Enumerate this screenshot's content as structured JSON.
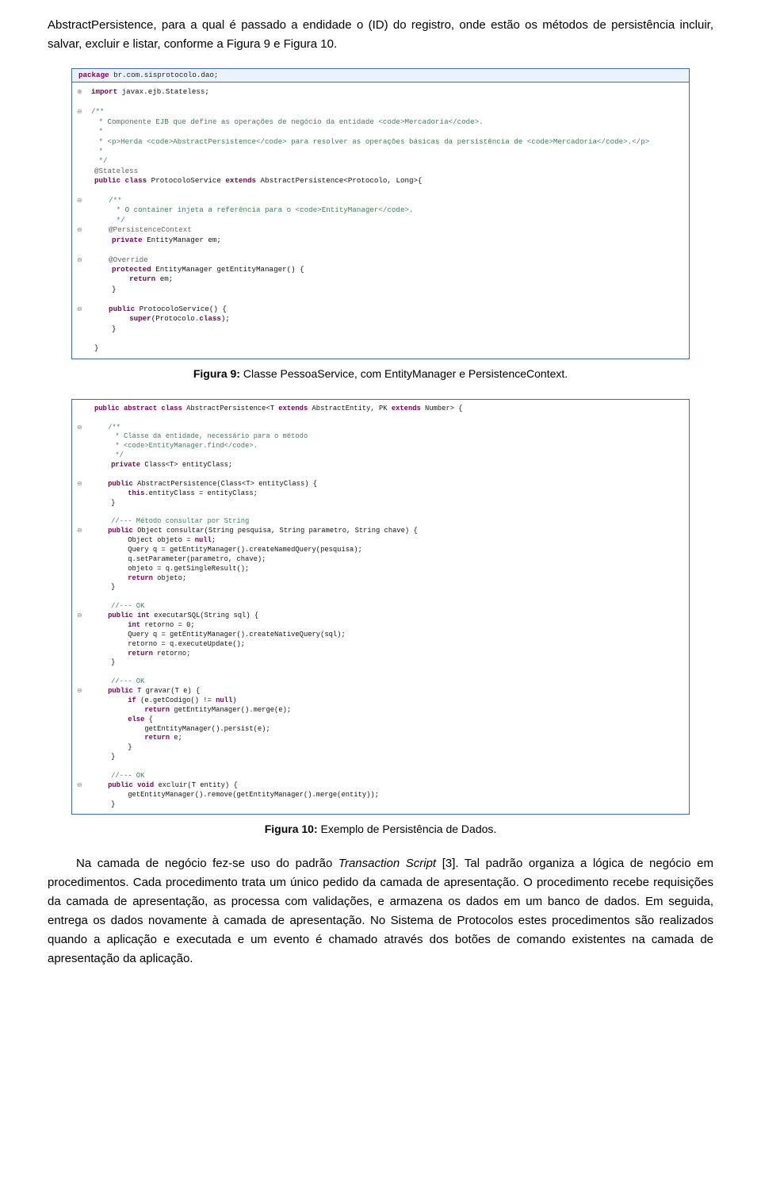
{
  "para_top_line1": "AbstractPersistence, para a qual é passado a endidade o (ID) do registro, onde estão os",
  "para_top_line2": "métodos de persistência incluir, salvar, excluir e listar, conforme a Figura 9 e Figura 10.",
  "code1_pkg_kw": "package",
  "code1_pkg_rest": " br.com.sisprotocolo.dao;",
  "code1_import_kw": "import",
  "code1_import_rest": " javax.ejb.Stateless;",
  "code1_c1": "/**",
  "code1_c2": " * Componente EJB que define as operações de negócio da entidade <code>Mercadoria</code>.",
  "code1_c3": " * ",
  "code1_c4": " * <p>Herda <code>AbstractPersistence</code> para resolver as operações básicas da persistência de <code>Mercadoria</code>.</p>",
  "code1_c5": " * ",
  "code1_c6": " */",
  "code1_ann": "@Stateless",
  "code1_decl_pub": "public class",
  "code1_decl_name": " ProtocoloService ",
  "code1_decl_ext": "extends",
  "code1_decl_rest": " AbstractPersistence<Protocolo, Long>{",
  "code1_c7": "    /**",
  "code1_c8": "     * O container injeta a referência para o <code>EntityManager</code>.",
  "code1_c9": "     */",
  "code1_ann2": "    @PersistenceContext",
  "code1_em_priv": "    private",
  "code1_em_rest": " EntityManager em;",
  "code1_ann3": "    @Override",
  "code1_get_prot": "    protected",
  "code1_get_rest": " EntityManager getEntityManager() {",
  "code1_get_ret_kw": "        return",
  "code1_get_ret_rest": " em;",
  "code1_close1": "    }",
  "code1_ctor_pub": "    public",
  "code1_ctor_rest": " ProtocoloService() {",
  "code1_ctor_body_kw": "        super",
  "code1_ctor_body_rest": "(Protocolo.",
  "code1_ctor_body_cls": "class",
  "code1_ctor_body_end": ");",
  "code1_close2": "    }",
  "code1_close3": "}",
  "fig9_label": "Figura 9:",
  "fig9_text": " Classe PessoaService, com EntityManager e PersistenceContext.",
  "code2_decl_pub": "public abstract class",
  "code2_decl_name": " AbstractPersistence<T ",
  "code2_decl_ext": "extends",
  "code2_decl_name2": " AbstractEntity, PK ",
  "code2_decl_ext2": "extends",
  "code2_decl_rest": " Number> {",
  "code2_c1": "    /**",
  "code2_c2": "     * Classe da entidade, necessário para o método",
  "code2_c3": "     * <code>EntityManager.find</code>.",
  "code2_c4": "     */",
  "code2_f_priv": "    private",
  "code2_f_rest": " Class<T> entityClass;",
  "code2_ctor_pub": "    public",
  "code2_ctor_rest": " AbstractPersistence(Class<T> entityClass) {",
  "code2_ctor_body_kw": "        this",
  "code2_ctor_body_rest": ".entityClass = entityClass;",
  "code2_close1": "    }",
  "code2_c5": "    //--- Método consultar por String",
  "code2_m1_pub": "    public",
  "code2_m1_rest": " Object consultar(String pesquisa, String parametro, String chave) {",
  "code2_m1_l1": "        Object objeto = ",
  "code2_m1_l1_kw": "null",
  "code2_m1_l1_end": ";",
  "code2_m1_l2": "        Query q = getEntityManager().createNamedQuery(pesquisa);",
  "code2_m1_l3": "        q.setParameter(parametro, chave);",
  "code2_m1_l4": "        objeto = q.getSingleResult();",
  "code2_m1_l5_kw": "        return",
  "code2_m1_l5_rest": " objeto;",
  "code2_close_m1": "    }",
  "code2_c6": "    //--- OK",
  "code2_m2_pub": "    public int",
  "code2_m2_rest": " executarSQL(String sql) {",
  "code2_m2_l1_kw": "        int",
  "code2_m2_l1_rest": " retorno = 0;",
  "code2_m2_l2": "        Query q = getEntityManager().createNativeQuery(sql);",
  "code2_m2_l3": "        retorno = q.executeUpdate();",
  "code2_m2_l4_kw": "        return",
  "code2_m2_l4_rest": " retorno;",
  "code2_close_m2": "    }",
  "code2_c7": "    //--- OK",
  "code2_m3_pub": "    public",
  "code2_m3_rest": " T gravar(T e) {",
  "code2_m3_l1_kw": "        if",
  "code2_m3_l1_rest": " (e.getCodigo() != ",
  "code2_m3_l1_kw2": "null",
  "code2_m3_l1_end": ")",
  "code2_m3_l2_kw": "            return",
  "code2_m3_l2_rest": " getEntityManager().merge(e);",
  "code2_m3_l3_kw": "        else",
  "code2_m3_l3_rest": " {",
  "code2_m3_l4": "            getEntityManager().persist(e);",
  "code2_m3_l5_kw": "            return",
  "code2_m3_l5_rest": " e;",
  "code2_m3_l6": "        }",
  "code2_close_m3": "    }",
  "code2_c8": "    //--- OK",
  "code2_m4_pub": "    public void",
  "code2_m4_rest": " excluir(T entity) {",
  "code2_m4_l1": "        getEntityManager().remove(getEntityManager().merge(entity));",
  "code2_close_m4": "    }",
  "fig10_label": "Figura 10:",
  "fig10_text": " Exemplo de Persistência de Dados.",
  "p2_l1": "Na camada de negócio fez-se uso do padrão ",
  "p2_em": "Transaction Script ",
  "p2_l2": "[3]. Tal padrão organiza a lógica de negócio em procedimentos. Cada procedimento trata um único pedido da camada de apresentação. O procedimento recebe requisições da camada de apresentação, as processa com validações, e armazena os dados em um banco de dados. Em seguida, entrega os dados novamente à camada de apresentação. No Sistema de Protocolos estes procedimentos são realizados quando a aplicação e executada e um evento é chamado através dos botões de comando existentes na camada de apresentação da aplicação."
}
